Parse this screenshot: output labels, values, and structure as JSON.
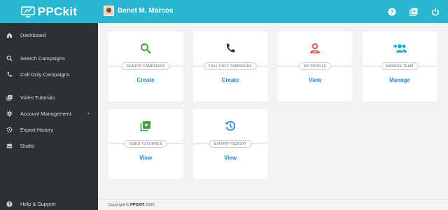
{
  "brand": {
    "name": "PPCkit"
  },
  "user": {
    "name": "Benet M. Marcos"
  },
  "topbar": {
    "icons": [
      "help-icon",
      "video-library-icon",
      "power-icon"
    ]
  },
  "sidebar": {
    "items": [
      {
        "label": "Dashboard",
        "icon": "home-icon"
      },
      {
        "label": "Search Campaigns",
        "icon": "search-icon"
      },
      {
        "label": "Call Only Campaigns",
        "icon": "phone-icon"
      },
      {
        "label": "Video Tutorials",
        "icon": "video-icon"
      },
      {
        "label": "Account Management",
        "icon": "gear-icon",
        "caret": "▾"
      },
      {
        "label": "Export History",
        "icon": "history-icon"
      },
      {
        "label": "Drafts",
        "icon": "inbox-icon"
      },
      {
        "label": "Help & Support",
        "icon": "help-icon"
      }
    ]
  },
  "cards": [
    {
      "label": "SEARCH CAMPAIGNS",
      "action": "Create",
      "icon": "search-icon",
      "color": "#43a047"
    },
    {
      "label": "CALL ONLY CAMPAIGNS",
      "action": "Create",
      "icon": "phone-icon",
      "color": "#333333"
    },
    {
      "label": "MY PROFILE",
      "action": "View",
      "icon": "person-icon",
      "color": "#e53935"
    },
    {
      "label": "MANAGE TEAM",
      "action": "Manage",
      "icon": "group-add-icon",
      "color": "#00acc1"
    },
    {
      "label": "VIDEO TUTORIALS",
      "action": "View",
      "icon": "video-library-icon",
      "color": "#43a047"
    },
    {
      "label": "EXPORT HISTORY",
      "action": "View",
      "icon": "history-icon",
      "color": "#1e88e5"
    }
  ],
  "footer": {
    "prefix": "Copyright ©",
    "brand": "PPCKIT",
    "year": "2020"
  },
  "colors": {
    "topbar": "#29b6d1",
    "sidebar": "#2d3035",
    "link": "#1e88e5"
  }
}
